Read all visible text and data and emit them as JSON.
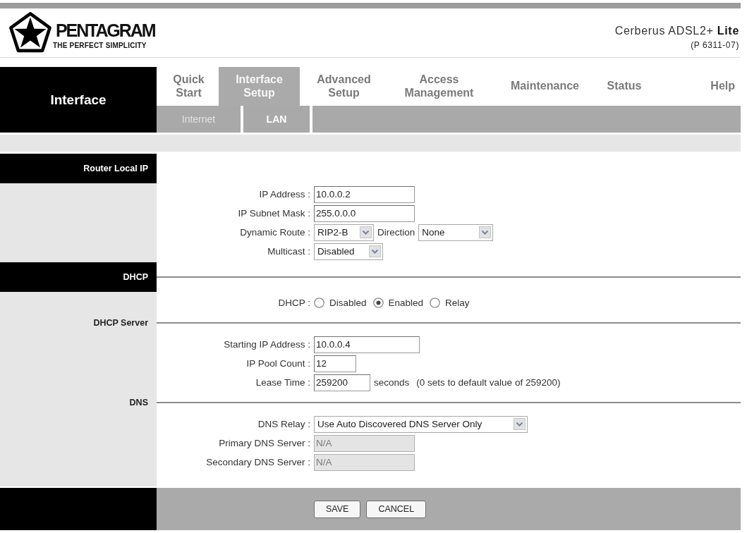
{
  "header": {
    "logo": {
      "wordmark": "PENTAGRAM",
      "tagline": "THE PERFECT SIMPLICITY"
    },
    "product": {
      "name": "Cerberus ADSL2+ **Lite**",
      "model": "(P 6311-07)"
    }
  },
  "nav": {
    "title": "Interface",
    "tabs": [
      {
        "label": "Quick Start",
        "selected": false
      },
      {
        "label": "Interface Setup",
        "selected": true
      },
      {
        "label": "Advanced Setup",
        "selected": false
      },
      {
        "label": "Access Management",
        "selected": false
      },
      {
        "label": "Maintenance",
        "selected": false
      },
      {
        "label": "Status",
        "selected": false
      },
      {
        "label": "Help",
        "selected": false
      }
    ],
    "subtabs": [
      {
        "label": "Internet",
        "selected": false
      },
      {
        "label": "LAN",
        "selected": true
      }
    ]
  },
  "sections": [
    {
      "title": "Router Local IP",
      "kind": "header",
      "rows": [
        {
          "label": "IP Address :",
          "controls": [
            {
              "kind": "input",
              "value": "10.0.0.2",
              "disabled": false
            }
          ]
        },
        {
          "label": "IP Subnet Mask :",
          "controls": [
            {
              "kind": "input",
              "value": "255.0.0.0",
              "disabled": false
            }
          ]
        },
        {
          "label": "Dynamic Route :",
          "controls": [
            {
              "kind": "select",
              "value": "RIP2-B",
              "disabled": false
            },
            {
              "kind": "label",
              "text": "Direction"
            },
            {
              "kind": "select",
              "value": "None",
              "disabled": false
            }
          ]
        },
        {
          "label": "Multicast :",
          "controls": [
            {
              "kind": "select",
              "value": "Disabled",
              "disabled": false
            }
          ]
        }
      ]
    },
    {
      "title": "DHCP",
      "kind": "header",
      "rows": [
        {
          "label": "DHCP :",
          "controls": [
            {
              "kind": "radio",
              "label": "Disabled",
              "selected": false
            },
            {
              "kind": "radio",
              "label": "Enabled",
              "selected": true
            },
            {
              "kind": "radio",
              "label": "Relay",
              "selected": false
            }
          ]
        }
      ]
    },
    {
      "title": "DHCP Server",
      "kind": "subheader",
      "rows": [
        {
          "label": "Starting IP Address :",
          "controls": [
            {
              "kind": "input",
              "value": "10.0.0.4",
              "disabled": false
            }
          ]
        },
        {
          "label": "IP Pool Count :",
          "controls": [
            {
              "kind": "input",
              "value": "12",
              "disabled": false
            }
          ]
        },
        {
          "label": "Lease Time :",
          "controls": [
            {
              "kind": "input",
              "value": "259200",
              "disabled": false
            },
            {
              "kind": "unit",
              "text": "seconds"
            },
            {
              "kind": "note",
              "text": "(0 sets to default value of 259200)"
            }
          ]
        }
      ]
    },
    {
      "title": "DNS",
      "kind": "subheader",
      "rows": [
        {
          "label": "DNS Relay :",
          "controls": [
            {
              "kind": "select",
              "value": "Use Auto Discovered DNS Server Only",
              "disabled": false
            }
          ]
        },
        {
          "label": "Primary DNS Server :",
          "controls": [
            {
              "kind": "input",
              "value": "N/A",
              "disabled": true
            }
          ]
        },
        {
          "label": "Secondary DNS Server :",
          "controls": [
            {
              "kind": "input",
              "value": "N/A",
              "disabled": true
            }
          ]
        }
      ]
    }
  ],
  "buttons": [
    {
      "label": "SAVE"
    },
    {
      "label": "CANCEL"
    }
  ]
}
